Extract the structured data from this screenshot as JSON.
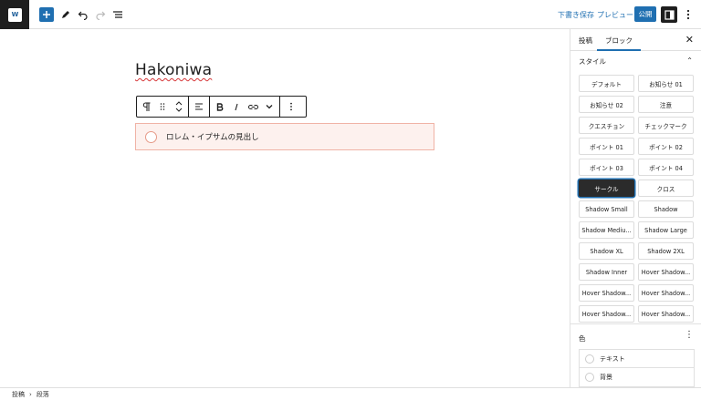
{
  "topbar": {
    "logo_text": "W",
    "save_draft": "下書き保存",
    "preview": "プレビュー",
    "publish": "公開"
  },
  "editor": {
    "title": "Hakoniwa",
    "heading_text": "ロレム・イプサムの見出し"
  },
  "statusbar": {
    "crumbs": [
      "投稿",
      "段落"
    ]
  },
  "sidebar": {
    "tabs": [
      "投稿",
      "ブロック"
    ],
    "active_tab": "ブロック",
    "styles_title": "スタイル",
    "styles": [
      "デフォルト",
      "お知らせ 01",
      "お知らせ 02",
      "注意",
      "クエスチョン",
      "チェックマーク",
      "ポイント 01",
      "ポイント 02",
      "ポイント 03",
      "ポイント 04",
      "サークル",
      "クロス",
      "Shadow Small",
      "Shadow",
      "Shadow Mediu...",
      "Shadow Large",
      "Shadow XL",
      "Shadow 2XL",
      "Shadow Inner",
      "Hover Shadow...",
      "Hover Shadow...",
      "Hover Shadow...",
      "Hover Shadow...",
      "Hover Shadow..."
    ],
    "active_style": "サークル",
    "color_title": "色",
    "color_items": [
      "テキスト",
      "背景"
    ]
  },
  "colors": {
    "accent": "#1f6fb1",
    "dark": "#1e1e1e",
    "heading_bg": "#fdf1ee",
    "heading_border": "#f0b3a6"
  }
}
